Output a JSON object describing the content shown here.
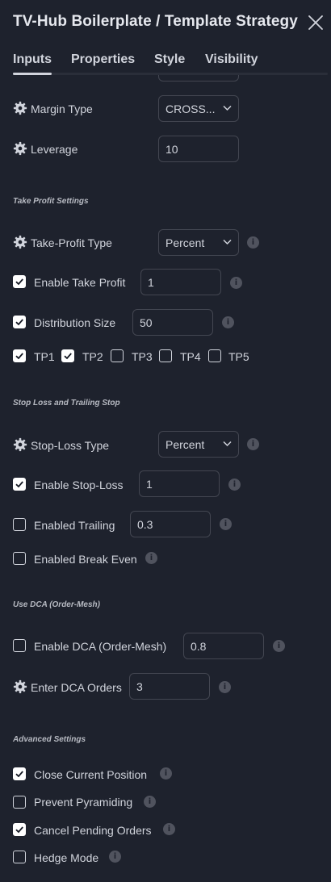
{
  "header": {
    "title": "TV-Hub Boilerplate / Template Strategy"
  },
  "tabs": [
    {
      "label": "Inputs",
      "active": true
    },
    {
      "label": "Properties",
      "active": false
    },
    {
      "label": "Style",
      "active": false
    },
    {
      "label": "Visibility",
      "active": false
    }
  ],
  "general": {
    "margin_type": {
      "label": "Margin Type",
      "value": "CROSS..."
    },
    "leverage": {
      "label": "Leverage",
      "value": "10"
    }
  },
  "take_profit": {
    "section_title": "Take Profit Settings",
    "tp_type": {
      "label": "Take-Profit Type",
      "value": "Percent"
    },
    "enable_tp": {
      "label": "Enable Take Profit",
      "checked": true,
      "value": "1"
    },
    "distribution": {
      "label": "Distribution Size",
      "checked": true,
      "value": "50"
    },
    "levels": [
      {
        "label": "TP1",
        "checked": true
      },
      {
        "label": "TP2",
        "checked": true
      },
      {
        "label": "TP3",
        "checked": false
      },
      {
        "label": "TP4",
        "checked": false
      },
      {
        "label": "TP5",
        "checked": false
      }
    ]
  },
  "stop_loss": {
    "section_title": "Stop Loss and Trailing Stop",
    "sl_type": {
      "label": "Stop-Loss Type",
      "value": "Percent"
    },
    "enable_sl": {
      "label": "Enable Stop-Loss",
      "checked": true,
      "value": "1"
    },
    "trailing": {
      "label": "Enabled Trailing",
      "checked": false,
      "value": "0.3"
    },
    "break_even": {
      "label": "Enabled Break Even",
      "checked": false
    }
  },
  "dca": {
    "section_title": "Use DCA (Order-Mesh)",
    "enable_dca": {
      "label": "Enable DCA (Order-Mesh)",
      "checked": false,
      "value": "0.8"
    },
    "dca_orders": {
      "label": "Enter DCA Orders",
      "value": "3"
    }
  },
  "advanced": {
    "section_title": "Advanced Settings",
    "close_current": {
      "label": "Close Current Position",
      "checked": true
    },
    "prevent_pyramiding": {
      "label": "Prevent Pyramiding",
      "checked": false
    },
    "cancel_pending": {
      "label": "Cancel Pending Orders",
      "checked": true
    },
    "hedge_mode": {
      "label": "Hedge Mode",
      "checked": false
    }
  },
  "icons": {
    "info_glyph": "i"
  },
  "colors": {
    "background": "#1e222d",
    "text": "#d1d4dc",
    "border": "#434651",
    "info": "#50535e",
    "checkbox_fill": "#ffffff"
  }
}
